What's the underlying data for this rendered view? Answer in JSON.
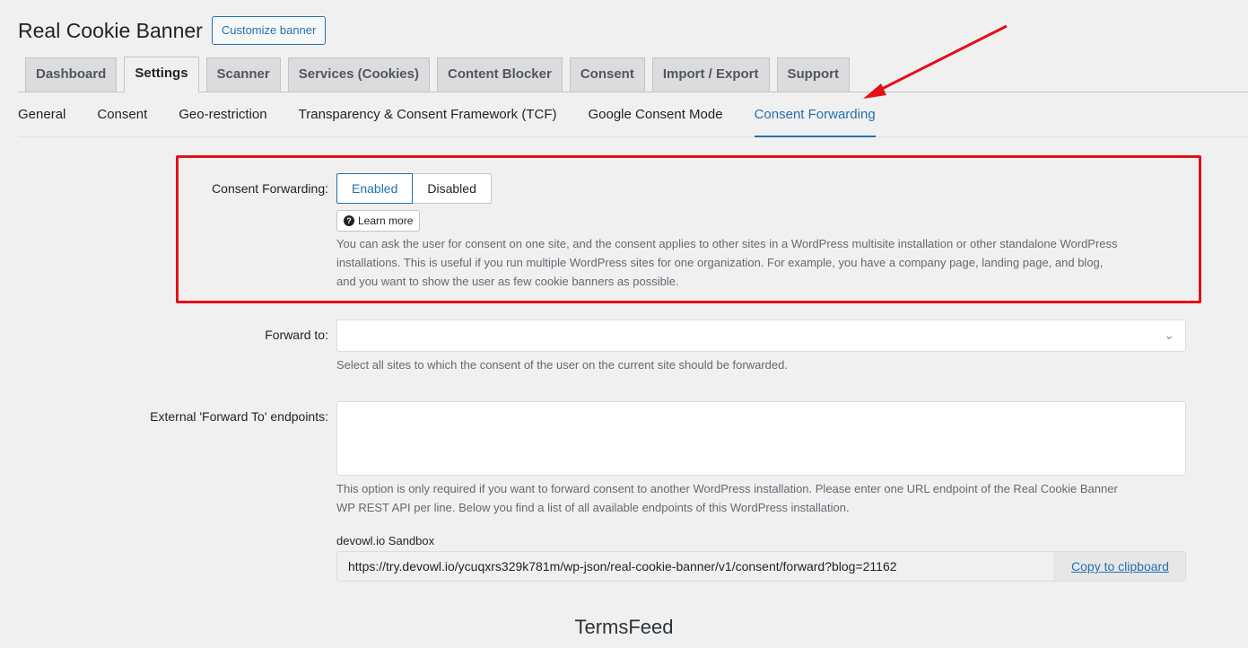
{
  "header": {
    "title": "Real Cookie Banner",
    "customize_label": "Customize banner"
  },
  "tabs": [
    {
      "label": "Dashboard"
    },
    {
      "label": "Settings"
    },
    {
      "label": "Scanner"
    },
    {
      "label": "Services (Cookies)"
    },
    {
      "label": "Content Blocker"
    },
    {
      "label": "Consent"
    },
    {
      "label": "Import / Export"
    },
    {
      "label": "Support"
    }
  ],
  "active_tab": "Settings",
  "subtabs": [
    {
      "label": "General"
    },
    {
      "label": "Consent"
    },
    {
      "label": "Geo-restriction"
    },
    {
      "label": "Transparency & Consent Framework (TCF)"
    },
    {
      "label": "Google Consent Mode"
    },
    {
      "label": "Consent Forwarding"
    }
  ],
  "active_subtab": "Consent Forwarding",
  "consent_forwarding": {
    "label": "Consent Forwarding:",
    "enabled_label": "Enabled",
    "disabled_label": "Disabled",
    "selected": "Enabled",
    "learn_more": "Learn more",
    "description_lines": [
      "You can ask the user for consent on one site, and the consent applies to other sites in a WordPress multisite installation or other standalone WordPress",
      "installations. This is useful if you run multiple WordPress sites for one organization. For example, you have a company page, landing page, and blog,",
      "and you want to show the user as few cookie banners as possible."
    ]
  },
  "forward_to": {
    "label": "Forward to:",
    "value": "",
    "description": "Select all sites to which the consent of the user on the current site should be forwarded."
  },
  "external_endpoints": {
    "label": "External 'Forward To' endpoints:",
    "value": "",
    "description_lines": [
      "This option is only required if you want to forward consent to another WordPress installation. Please enter one URL endpoint of the Real Cookie Banner",
      "WP REST API per line. Below you find a list of all available endpoints of this WordPress installation."
    ],
    "site_name": "devowl.io Sandbox",
    "endpoint_url": "https://try.devowl.io/ycuqxrs329k781m/wp-json/real-cookie-banner/v1/consent/forward?blog=21162",
    "copy_label": "Copy to clipboard"
  },
  "watermark": "TermsFeed",
  "colors": {
    "accent": "#2271b1",
    "highlight": "#e3101a"
  }
}
